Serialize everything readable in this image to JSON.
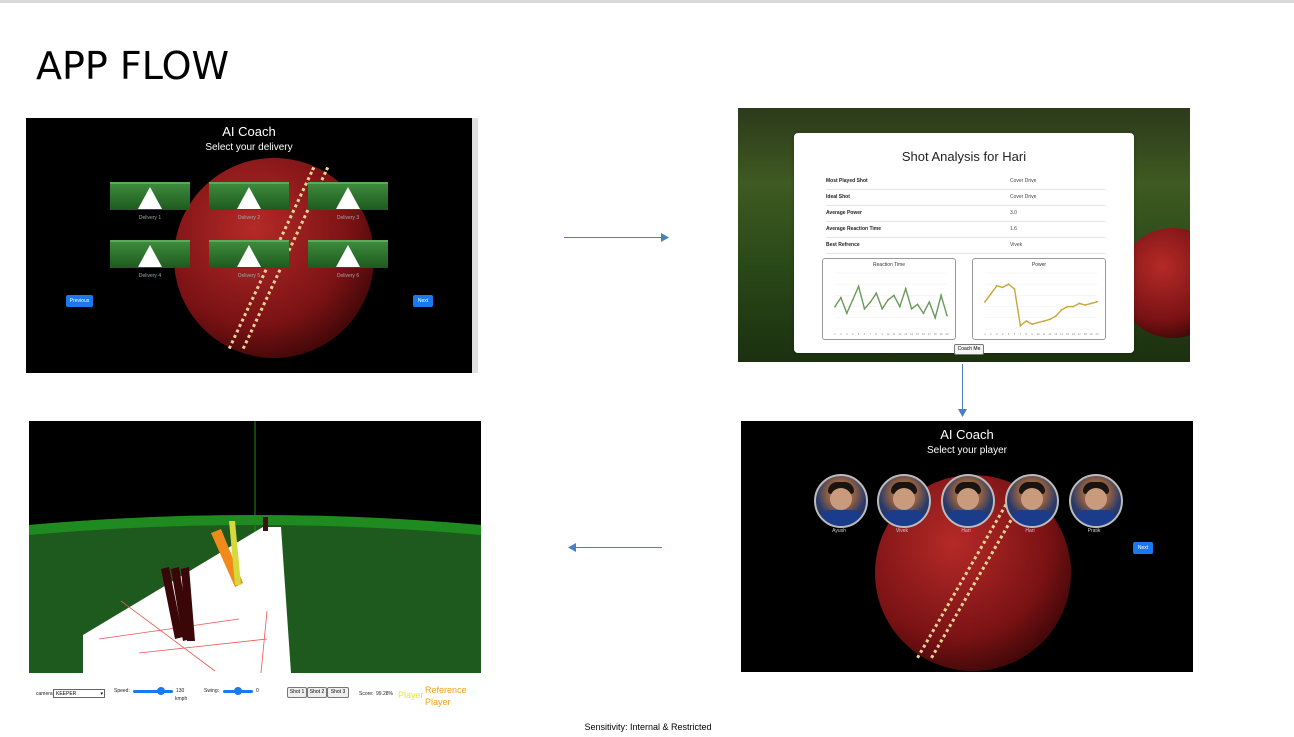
{
  "slide": {
    "title": "APP FLOW",
    "footer": "Sensitivity: Internal & Restricted"
  },
  "screen_delivery": {
    "app_title": "AI Coach",
    "subtitle": "Select your delivery",
    "deliveries": [
      "Delivery 1",
      "Delivery 2",
      "Delivery 3",
      "Delivery 4",
      "Delivery 5",
      "Delivery 6"
    ],
    "prev_label": "Previous",
    "next_label": "Next"
  },
  "screen_analysis": {
    "heading": "Shot Analysis for Hari",
    "rows": [
      {
        "key": "Most Played Shot",
        "value": "Cover Drive"
      },
      {
        "key": "Ideal Shot",
        "value": "Cover Drive"
      },
      {
        "key": "Average Power",
        "value": "3.0"
      },
      {
        "key": "Average Reaction Time",
        "value": "1.6"
      },
      {
        "key": "Best Refrence",
        "value": "Vivek"
      }
    ],
    "chart_reaction_title": "Reaction Time",
    "chart_power_title": "Power",
    "coach_button": "Coach Me"
  },
  "chart_data": [
    {
      "type": "line",
      "title": "Reaction Time",
      "x": [
        1,
        2,
        3,
        4,
        5,
        6,
        7,
        8,
        9,
        10,
        11,
        12,
        13,
        14,
        15,
        16,
        17,
        18,
        19,
        20
      ],
      "values": [
        1.0,
        1.4,
        0.7,
        1.3,
        1.9,
        0.9,
        1.2,
        1.6,
        0.9,
        1.3,
        1.5,
        1.0,
        1.8,
        0.9,
        1.1,
        0.7,
        1.2,
        0.5,
        1.5,
        0.6
      ],
      "ylim": [
        0,
        2.5
      ],
      "color": "#6a9a5b"
    },
    {
      "type": "line",
      "title": "Power",
      "x": [
        1,
        2,
        3,
        4,
        5,
        6,
        7,
        8,
        9,
        10,
        11,
        12,
        13,
        14,
        15,
        16,
        17,
        18,
        19,
        20
      ],
      "values": [
        17,
        22,
        27,
        26,
        28,
        25,
        2,
        5,
        3,
        4,
        5,
        6,
        8,
        12,
        14,
        14,
        16,
        15,
        16,
        17
      ],
      "ylim": [
        0,
        35
      ],
      "color": "#c9a53a"
    }
  ],
  "screen_player": {
    "app_title": "AI Coach",
    "subtitle": "Select your player",
    "players": [
      "Ayush",
      "Vivek",
      "Hari",
      "Hari",
      "Pratik"
    ],
    "next_label": "Next"
  },
  "screen_sim": {
    "camera_label": "camera",
    "camera_value": "KEEPER",
    "speed_label": "Speed:",
    "speed_value": "130",
    "speed_unit": "kmph",
    "swing_label": "Swing:",
    "swing_value": "0",
    "shots": [
      "Shot 1",
      "Shot 2",
      "Shot 3"
    ],
    "score_label": "Score:",
    "score_value": "99.28%",
    "legend_player": "Player",
    "legend_reference": "Reference Player"
  },
  "colors": {
    "arrow": "#4a7fc4",
    "accent_blue": "#1a78f0",
    "pitch_green": "#1e5a1e"
  }
}
